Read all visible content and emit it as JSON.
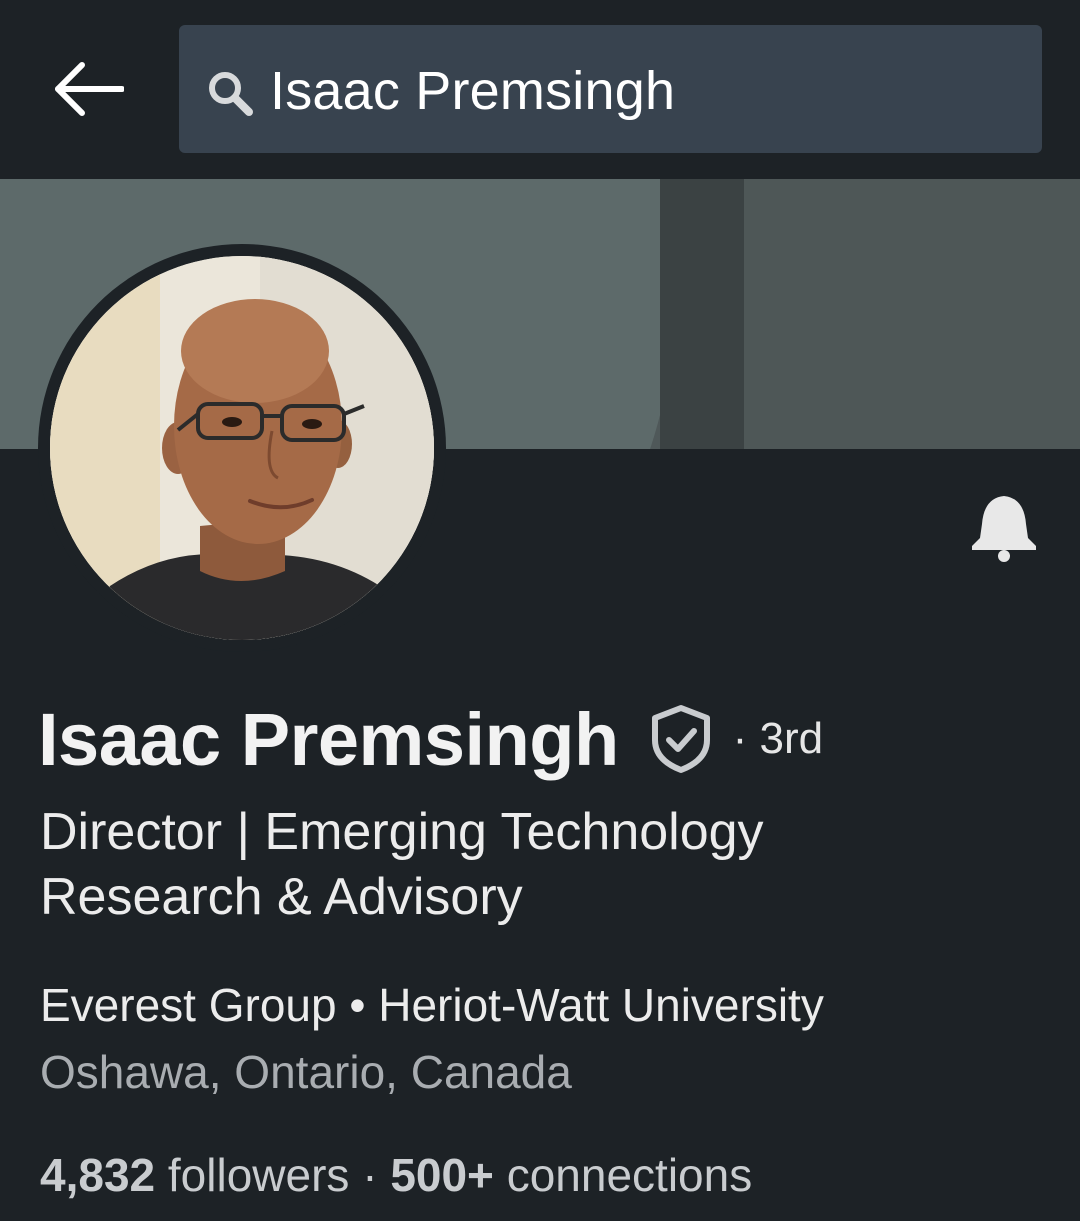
{
  "search": {
    "query": "Isaac Premsingh"
  },
  "profile": {
    "name": "Isaac Premsingh",
    "connection_degree": "· 3rd",
    "headline": "Director | Emerging Technology Research & Advisory",
    "company": "Everest Group",
    "separator": " • ",
    "school": "Heriot-Watt University",
    "location": "Oshawa, Ontario, Canada",
    "followers_count": "4,832",
    "followers_label": " followers",
    "stats_separator": " · ",
    "connections_count": "500+",
    "connections_label": " connections"
  },
  "icons": {
    "back": "arrow-left-icon",
    "search": "search-icon",
    "verified": "shield-check-icon",
    "bell": "bell-icon"
  },
  "colors": {
    "background": "#1d2226",
    "search_bg": "#38434f",
    "banner": "#5d6a6a",
    "text_primary": "#f2f2f2",
    "text_secondary": "#a9adb1"
  }
}
